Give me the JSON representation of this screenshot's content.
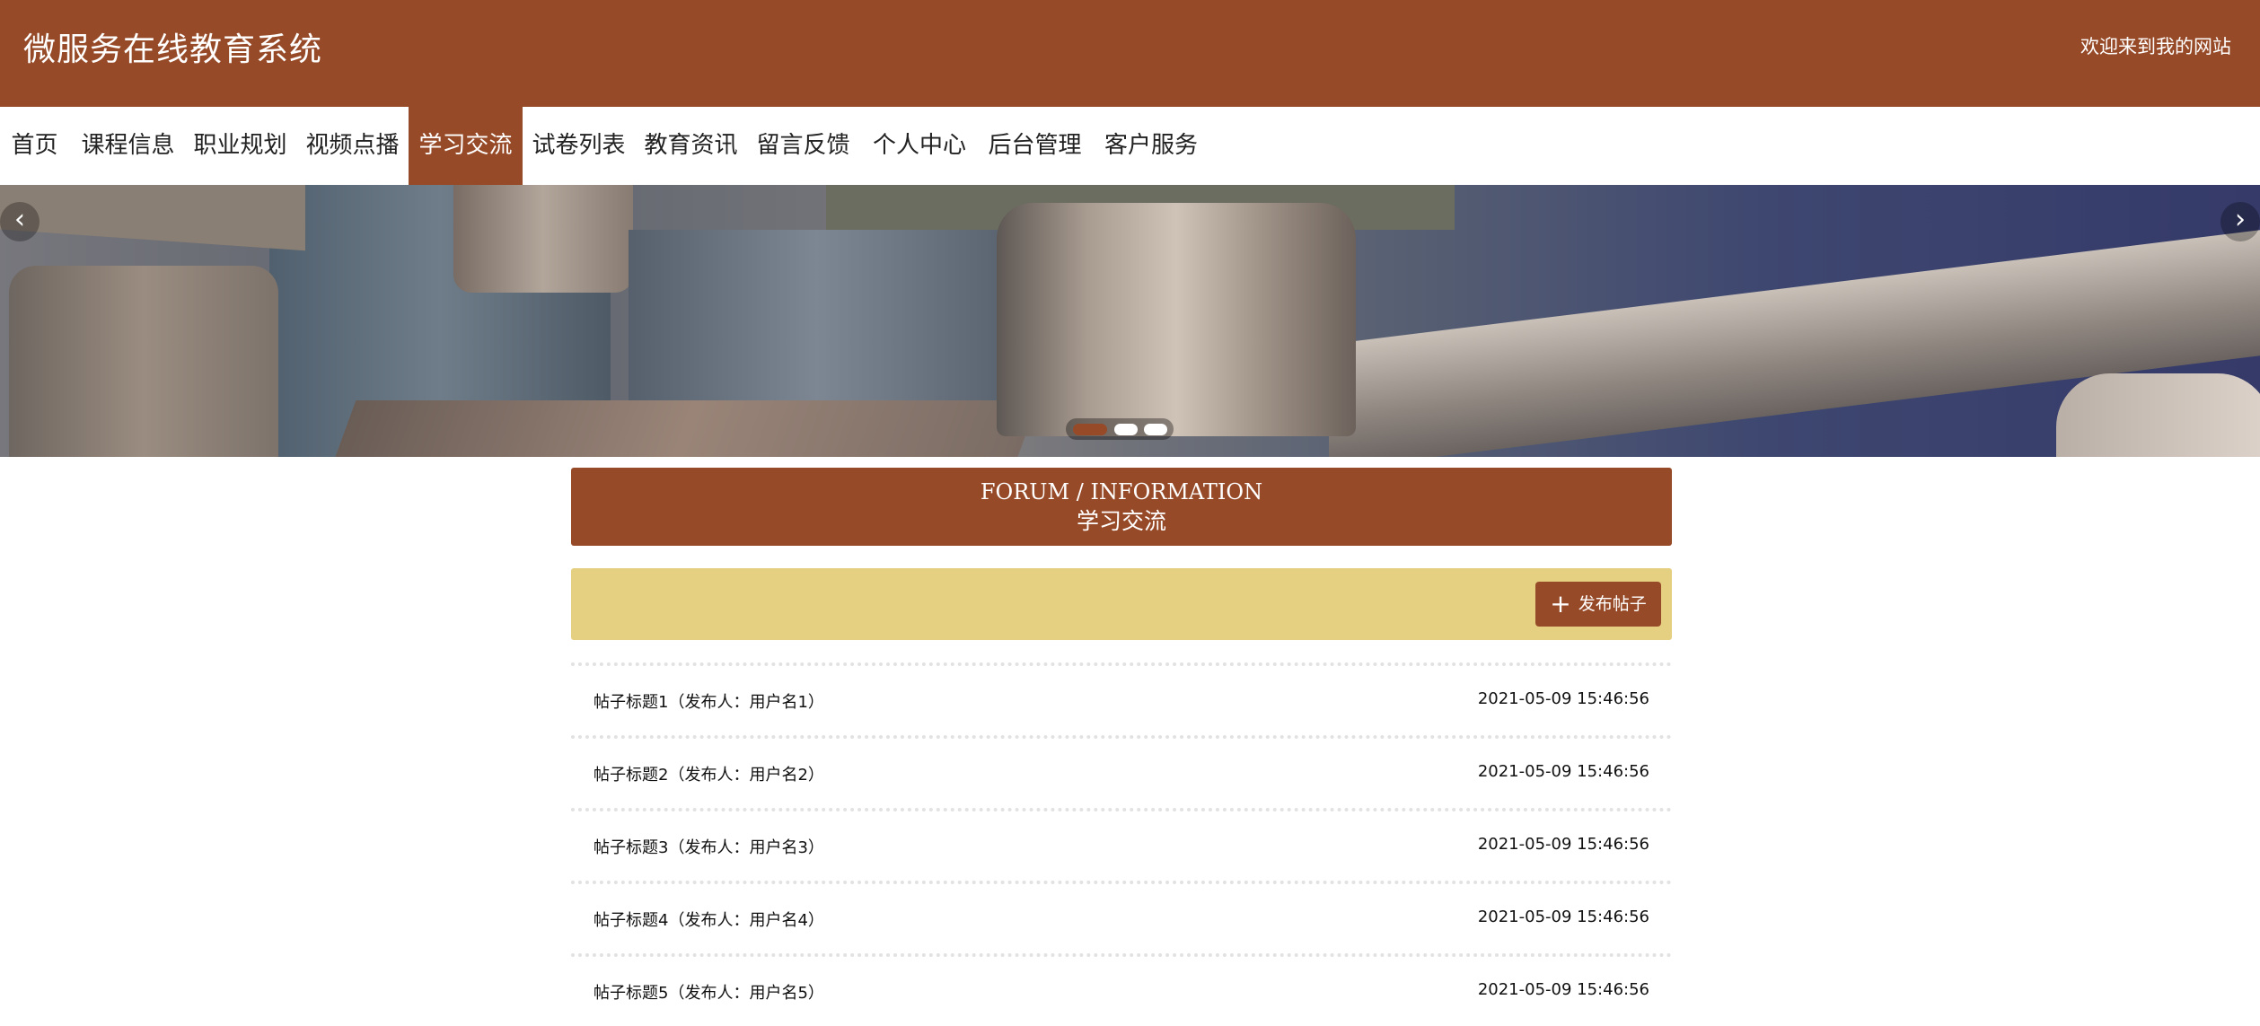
{
  "header": {
    "site_title": "微服务在线教育系统",
    "welcome": "欢迎来到我的网站",
    "color": "#974a28"
  },
  "nav": {
    "items": [
      {
        "label": "首页"
      },
      {
        "label": "课程信息"
      },
      {
        "label": "职业规划"
      },
      {
        "label": "视频点播"
      },
      {
        "label": "学习交流",
        "active": true
      },
      {
        "label": "试卷列表"
      },
      {
        "label": "教育资讯"
      },
      {
        "label": "留言反馈"
      },
      {
        "label": "个人中心"
      },
      {
        "label": "后台管理"
      },
      {
        "label": "客户服务"
      }
    ]
  },
  "banner": {
    "prev_icon": "chevron-left-icon",
    "next_icon": "chevron-right-icon",
    "prev_glyph": "‹",
    "next_glyph": "›",
    "slide_count": 3,
    "active_slide": 1
  },
  "forum": {
    "title_en": "FORUM / INFORMATION",
    "title_cn": "学习交流",
    "toolbar_color": "#e5cf81",
    "post_button": {
      "icon": "plus-icon",
      "glyph": "+",
      "label": "发布帖子"
    },
    "posts": [
      {
        "title": "帖子标题1（发布人：用户名1）",
        "time": "2021-05-09 15:46:56"
      },
      {
        "title": "帖子标题2（发布人：用户名2）",
        "time": "2021-05-09 15:46:56"
      },
      {
        "title": "帖子标题3（发布人：用户名3）",
        "time": "2021-05-09 15:46:56"
      },
      {
        "title": "帖子标题4（发布人：用户名4）",
        "time": "2021-05-09 15:46:56"
      },
      {
        "title": "帖子标题5（发布人：用户名5）",
        "time": "2021-05-09 15:46:56"
      }
    ]
  }
}
